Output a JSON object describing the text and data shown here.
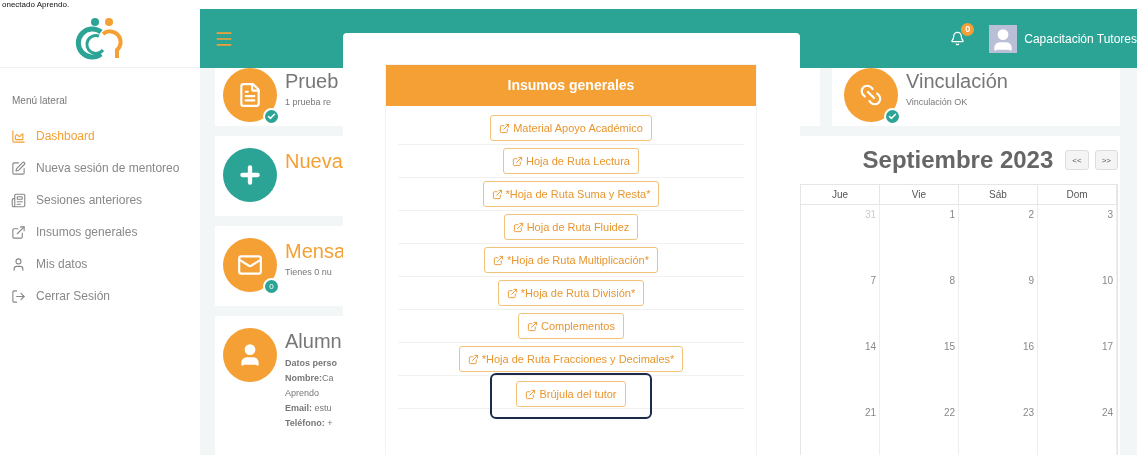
{
  "caption": "onectado Aprendo.",
  "sidebar": {
    "heading": "Menú lateral",
    "items": [
      {
        "kind": "chart",
        "label": "Dashboard",
        "selected": true
      },
      {
        "kind": "edit",
        "label": "Nueva sesión de mentoreo",
        "selected": false
      },
      {
        "kind": "list",
        "label": "Sesiones anteriores",
        "selected": false
      },
      {
        "kind": "link",
        "label": "Insumos generales",
        "selected": false
      },
      {
        "kind": "user",
        "label": "Mis datos",
        "selected": false
      },
      {
        "kind": "logout",
        "label": "Cerrar Sesión",
        "selected": false
      }
    ]
  },
  "topbar": {
    "notifications": "0",
    "user": "Capacitación Tutores"
  },
  "cards": [
    {
      "kind": "doc",
      "color": "#f4a034",
      "checked": true,
      "title": "Prueb",
      "accent": false,
      "subtitle": "1 prueba re"
    },
    {
      "kind": "plus",
      "color": "#2ca495",
      "title": "Nueva",
      "accent": true
    },
    {
      "kind": "mail",
      "color": "#f4a034",
      "badge": "0",
      "title": "Mensa",
      "accent": true,
      "subtitle": "Tienes 0 nu"
    },
    {
      "kind": "user",
      "color": "#f4a034",
      "title": "Alumn",
      "accent": false,
      "details": [
        {
          "kind": "heading",
          "value": "Datos perso"
        },
        {
          "label": "Nombre:",
          "value": "Ca"
        },
        {
          "value": "Aprendo"
        },
        {
          "label": "Email:",
          "value": " estu"
        },
        {
          "label": "Teléfono:",
          "value": " +"
        }
      ]
    }
  ],
  "link_card": {
    "title": "Vinculación",
    "subtitle": "Vinculación OK",
    "checked": true
  },
  "calendar": {
    "title": "Septiembre 2023",
    "prev": "<<",
    "next": ">>",
    "days": [
      "Jue",
      "Vie",
      "Sáb",
      "Dom"
    ],
    "weeks": [
      [
        {
          "day": "31",
          "other_month": true
        },
        {
          "day": "1",
          "other_month": false
        },
        {
          "day": "2",
          "other_month": false
        },
        {
          "day": "3",
          "other_month": false
        }
      ],
      [
        {
          "day": "7",
          "other_month": false
        },
        {
          "day": "8",
          "other_month": false
        },
        {
          "day": "9",
          "other_month": false
        },
        {
          "day": "10",
          "other_month": false
        }
      ],
      [
        {
          "day": "14",
          "other_month": false
        },
        {
          "day": "15",
          "other_month": false
        },
        {
          "day": "16",
          "other_month": false
        },
        {
          "day": "17",
          "other_month": false
        }
      ],
      [
        {
          "day": "21",
          "other_month": false
        },
        {
          "day": "22",
          "other_month": false
        },
        {
          "day": "23",
          "other_month": false
        },
        {
          "day": "24",
          "other_month": false
        }
      ]
    ]
  },
  "modal": {
    "title": "Insumos generales",
    "links": [
      {
        "label": "Material Apoyo Académico",
        "selected": false
      },
      {
        "label": "Hoja de Ruta Lectura",
        "selected": false
      },
      {
        "label": "*Hoja de Ruta Suma y Resta*",
        "selected": false
      },
      {
        "label": "Hoja de Ruta Fluidez",
        "selected": false
      },
      {
        "label": "*Hoja de Ruta Multiplicación*",
        "selected": false
      },
      {
        "label": "*Hoja de Ruta División*",
        "selected": false
      },
      {
        "label": "Complementos",
        "selected": false
      },
      {
        "label": "*Hoja de Ruta Fracciones y Decimales*",
        "selected": false
      },
      {
        "label": "Brújula del tutor",
        "selected": true
      }
    ]
  }
}
